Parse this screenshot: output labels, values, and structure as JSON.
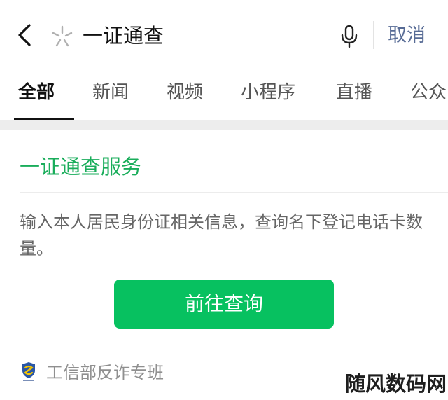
{
  "search": {
    "query": "一证通查",
    "cancel_label": "取消",
    "back_icon": "chevron-left-icon",
    "star_icon": "star-sparkle-icon",
    "mic_icon": "microphone-icon"
  },
  "tabs": [
    {
      "label": "全部",
      "active": true
    },
    {
      "label": "新闻",
      "active": false
    },
    {
      "label": "视频",
      "active": false
    },
    {
      "label": "小程序",
      "active": false
    },
    {
      "label": "直播",
      "active": false
    },
    {
      "label": "公众",
      "active": false
    }
  ],
  "service_card": {
    "title": "一证通查服务",
    "description": "输入本人居民身份证相关信息，查询名下登记电话卡数量。",
    "button_label": "前往查询",
    "source_name": "工信部反诈专班",
    "source_icon": "miit-shield-logo-icon"
  },
  "watermark": {
    "text": "随风数码网"
  },
  "colors": {
    "accent_green": "#07c160",
    "title_green": "#1aad5b",
    "link_blue": "#576b95",
    "band_gray": "#ededed"
  }
}
